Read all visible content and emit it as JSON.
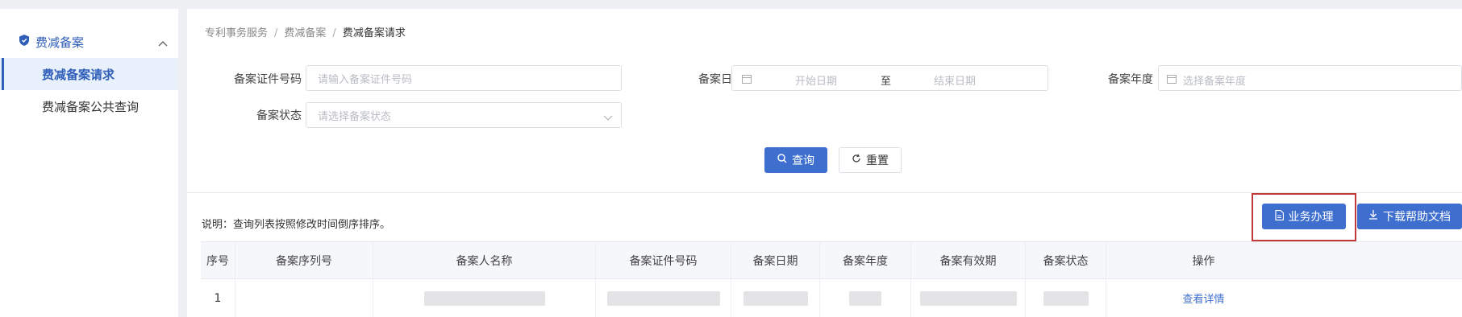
{
  "colors": {
    "accent": "#3e6fcf",
    "sidebar_active_bg": "#e8f0fb",
    "highlight_border": "#c0393b"
  },
  "sidebar": {
    "group": {
      "label": "费减备案",
      "icon": "shield-icon"
    },
    "items": [
      {
        "label": "费减备案请求",
        "active": true
      },
      {
        "label": "费减备案公共查询",
        "active": false
      }
    ]
  },
  "breadcrumb": {
    "items": [
      "专利事务服务",
      "费减备案"
    ],
    "separator": "/",
    "current": "费减备案请求"
  },
  "form": {
    "cert_number": {
      "label": "备案证件号码",
      "placeholder": "请输入备案证件号码"
    },
    "date": {
      "label": "备案日期",
      "start_placeholder": "开始日期",
      "to": "至",
      "end_placeholder": "结束日期"
    },
    "year": {
      "label": "备案年度",
      "placeholder": "选择备案年度"
    },
    "status": {
      "label": "备案状态",
      "placeholder": "请选择备案状态"
    }
  },
  "buttons": {
    "query": "查询",
    "reset": "重置",
    "business": "业务办理",
    "download": "下载帮助文档"
  },
  "note": "说明：查询列表按照修改时间倒序排序。",
  "table": {
    "headers": [
      "序号",
      "备案序列号",
      "备案人名称",
      "备案证件号码",
      "备案日期",
      "备案年度",
      "备案有效期",
      "备案状态",
      "操作"
    ],
    "rows": [
      {
        "index": "1",
        "action": "查看详情"
      }
    ]
  }
}
